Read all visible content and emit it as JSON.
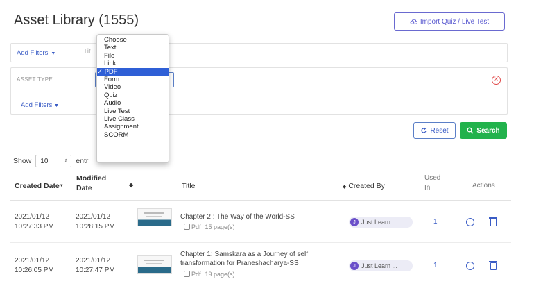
{
  "page": {
    "title": "Asset Library (1555)"
  },
  "import_button": {
    "label": "Import Quiz / Live Test"
  },
  "filter_bar": {
    "add_filters_label": "Add Filters",
    "input_placeholder": "Tit"
  },
  "filter_panel": {
    "asset_type_label": "ASSET TYPE",
    "selected_type": "PDF",
    "add_filters_label": "Add Filters"
  },
  "buttons": {
    "reset": "Reset",
    "search": "Search"
  },
  "entries": {
    "show_label": "Show",
    "value": "10",
    "suffix": "entri"
  },
  "table": {
    "headers": {
      "created_date": "Created Date",
      "modified_date_1": "Modified",
      "modified_date_2": "Date",
      "title": "Title",
      "created_by": "Created By",
      "used_in_1": "Used",
      "used_in_2": "In",
      "actions": "Actions"
    },
    "rows": [
      {
        "created_date": "2021/01/12",
        "created_time": "10:27:33 PM",
        "modified_date": "2021/01/12",
        "modified_time": "10:28:15 PM",
        "title_1": "Chapter 2 : The Way of the World-SS",
        "title_2": "",
        "type": "Pdf",
        "pages": "15 page(s)",
        "creator_initial": "J",
        "creator": "Just Learn ...",
        "used_in": "1"
      },
      {
        "created_date": "2021/01/12",
        "created_time": "10:26:05 PM",
        "modified_date": "2021/01/12",
        "modified_time": "10:27:47 PM",
        "title_1": "Chapter 1: Samskara as a Journey of self",
        "title_2": "transformation for Praneshacharya-SS",
        "type": "Pdf",
        "pages": "19 page(s)",
        "creator_initial": "J",
        "creator": "Just Learn ...",
        "used_in": "1"
      }
    ]
  },
  "asset_type_dropdown": {
    "options": [
      "Choose",
      "Text",
      "File",
      "Link",
      "✓ PDF",
      "Form",
      "Video",
      "Quiz",
      "Audio",
      "Live Test",
      "Live Class",
      "Assignment",
      "SCORM"
    ],
    "selected_index": 4
  },
  "colors": {
    "accent": "#3a5cc5",
    "success": "#22b24c",
    "danger": "#e04848",
    "selection": "#2f5fd6"
  }
}
